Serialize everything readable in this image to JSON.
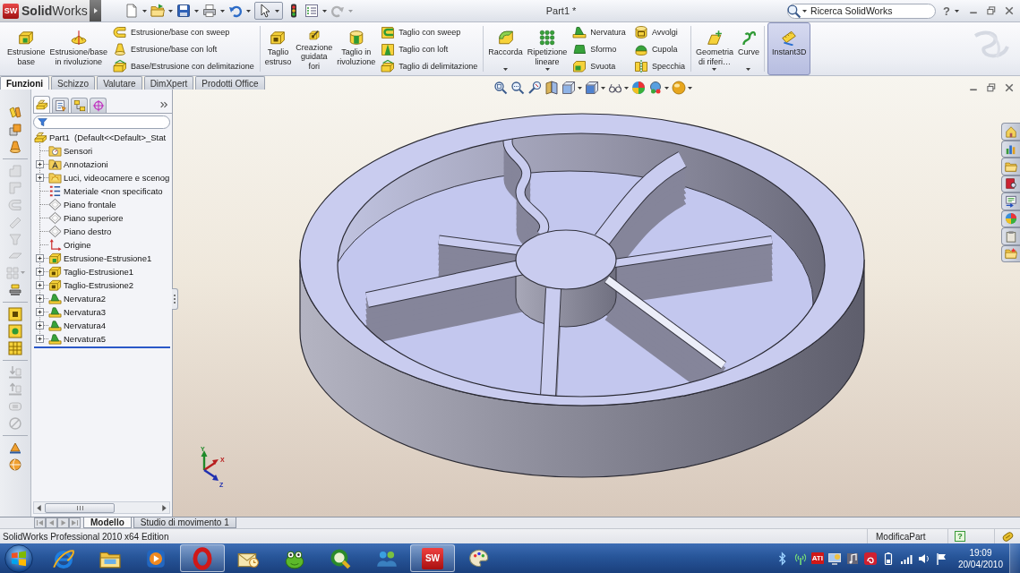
{
  "title_bar": {
    "logo_mark": "SW",
    "app_name": "**Solid**Works",
    "quick_access": [
      {
        "disabled": false
      },
      {
        "disabled": false
      },
      {
        "disabled": false
      },
      {
        "disabled": false
      },
      {
        "disabled": false
      },
      {
        "disabled": false
      },
      {
        "disabled": false
      },
      {
        "disabled": false
      },
      {
        "disabled": true
      }
    ],
    "document_title": "Part1 *",
    "search": {
      "placeholder": "Ricerca SolidWorks"
    },
    "help": "?"
  },
  "ribbon": {
    "groups": [
      {
        "commands": [
          {
            "kind": "large",
            "label": "Estrusione\nbase",
            "dropdown": false,
            "on": false
          },
          {
            "kind": "large",
            "label": "Estrusione/base\nin rivoluzione",
            "dropdown": false,
            "on": false
          },
          {
            "kind": "small",
            "label": "Estrusione/base con sweep",
            "on": false
          },
          {
            "kind": "small",
            "label": "Estrusione/base con loft",
            "on": false
          },
          {
            "kind": "small",
            "label": "Base/Estrusione con delimitazione",
            "on": false
          }
        ]
      },
      {
        "commands": [
          {
            "kind": "large",
            "label": "Taglio\nestruso",
            "dropdown": false,
            "on": false
          },
          {
            "kind": "large",
            "label": "Creazione\nguidata\nfori",
            "dropdown": false,
            "on": false
          },
          {
            "kind": "large",
            "label": "Taglio in\nrivoluzione",
            "dropdown": false,
            "on": false
          },
          {
            "kind": "small",
            "label": "Taglio con sweep",
            "on": false
          },
          {
            "kind": "small",
            "label": "Taglio con loft",
            "on": false
          },
          {
            "kind": "small",
            "label": "Taglio di delimitazione",
            "on": false
          }
        ]
      },
      {
        "commands": [
          {
            "kind": "large",
            "label": "Raccorda",
            "dropdown": true,
            "on": false
          },
          {
            "kind": "large",
            "label": "Ripetizione\nlineare",
            "dropdown": true,
            "on": false
          },
          {
            "kind": "small",
            "label": "Nervatura",
            "on": false
          },
          {
            "kind": "small",
            "label": "Sformo",
            "on": false
          },
          {
            "kind": "small",
            "label": "Svuota",
            "on": false
          },
          {
            "kind": "small",
            "label": "Avvolgi",
            "on": false
          },
          {
            "kind": "small",
            "label": "Cupola",
            "on": false
          },
          {
            "kind": "small",
            "label": "Specchia",
            "on": false
          }
        ]
      },
      {
        "commands": [
          {
            "kind": "large",
            "label": "Geometria\ndi riferi…",
            "dropdown": true,
            "on": false
          },
          {
            "kind": "large",
            "label": "Curve",
            "dropdown": true,
            "on": false
          }
        ]
      },
      {
        "commands": [
          {
            "kind": "large",
            "label": "Instant3D",
            "dropdown": false,
            "on": true
          }
        ]
      }
    ]
  },
  "command_tabs": [
    {
      "label": "Funzioni",
      "selected": true
    },
    {
      "label": "Schizzo",
      "selected": false
    },
    {
      "label": "Valutare",
      "selected": false
    },
    {
      "label": "DimXpert",
      "selected": false
    },
    {
      "label": "Prodotti Office",
      "selected": false
    }
  ],
  "side_toolbar": [
    {
      "disabled": false
    },
    {
      "disabled": false
    },
    {
      "disabled": false
    },
    {
      "disabled": true
    },
    {
      "disabled": true
    },
    {
      "disabled": true
    },
    {
      "disabled": true
    },
    {
      "disabled": true
    },
    {
      "disabled": true
    },
    {
      "disabled": true
    },
    {
      "disabled": false
    },
    {
      "disabled": false
    },
    {
      "disabled": false
    },
    {
      "disabled": false
    },
    {
      "disabled": true
    },
    {
      "disabled": true
    },
    {
      "disabled": true
    },
    {
      "disabled": true
    },
    {
      "disabled": false
    },
    {
      "disabled": false
    }
  ],
  "feature_manager": {
    "panel_tabs": [
      {
        "selected": true
      },
      {
        "selected": false
      },
      {
        "selected": false
      },
      {
        "selected": false
      }
    ],
    "tree": {
      "label": "Part1  (Default<<Default>_Stat",
      "children": [
        {
          "label": "Sensori",
          "expandable": false
        },
        {
          "label": "Annotazioni",
          "expandable": true
        },
        {
          "label": "Luci, videocamere e scenog",
          "expandable": true
        },
        {
          "label": "Materiale <non specificato",
          "expandable": false
        },
        {
          "label": "Piano frontale",
          "expandable": false
        },
        {
          "label": "Piano superiore",
          "expandable": false
        },
        {
          "label": "Piano destro",
          "expandable": false
        },
        {
          "label": "Origine",
          "expandable": false
        },
        {
          "label": "Estrusione-Estrusione1",
          "expandable": true
        },
        {
          "label": "Taglio-Estrusione1",
          "expandable": true
        },
        {
          "label": "Taglio-Estrusione2",
          "expandable": true
        },
        {
          "label": "Nervatura2",
          "expandable": true
        },
        {
          "label": "Nervatura3",
          "expandable": true
        },
        {
          "label": "Nervatura4",
          "expandable": true
        },
        {
          "label": "Nervatura5",
          "expandable": true
        }
      ]
    }
  },
  "viewport": {
    "triad": {
      "x": "X",
      "y": "Y",
      "z": "Z"
    }
  },
  "bottom_tabs": [
    {
      "label": "Modello",
      "selected": true
    },
    {
      "label": "Studio di movimento 1",
      "selected": false
    }
  ],
  "status_bar": {
    "edition": "SolidWorks Professional 2010 x64 Edition",
    "mode": "ModificaPart",
    "help": "?"
  },
  "taskbar": {
    "apps": [
      {
        "running": false
      },
      {
        "running": false
      },
      {
        "running": false
      },
      {
        "running": true
      },
      {
        "running": false
      },
      {
        "running": false
      },
      {
        "running": false
      },
      {
        "running": false
      },
      {
        "running": true,
        "badge": "SW"
      },
      {
        "running": false
      }
    ],
    "tray_badge": "ATI",
    "time": "19:09",
    "date": "20/04/2010"
  }
}
